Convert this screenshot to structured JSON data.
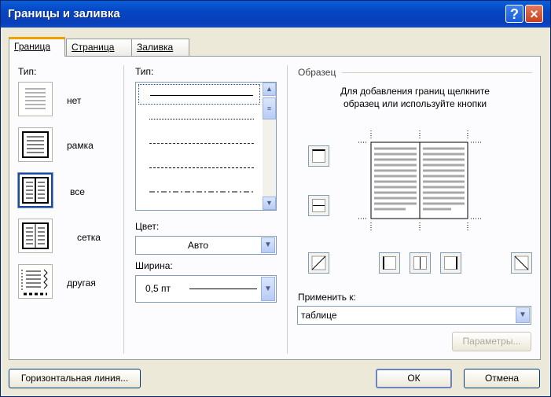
{
  "window": {
    "title": "Границы и заливка",
    "help": "?",
    "close": "×"
  },
  "tabs": [
    {
      "label": "Граница"
    },
    {
      "label": "Страница"
    },
    {
      "label": "Заливка"
    }
  ],
  "settings": {
    "heading": "Тип:",
    "items": [
      {
        "label": "нет"
      },
      {
        "label": "рамка"
      },
      {
        "label": "все"
      },
      {
        "label": "сетка"
      },
      {
        "label": "другая"
      }
    ],
    "selected": "все"
  },
  "style": {
    "heading": "Тип:",
    "styles": [
      "solid",
      "dotted",
      "dashed-fine",
      "dashed",
      "dash-dot"
    ],
    "selected": "solid"
  },
  "color": {
    "label": "Цвет:",
    "value": "Авто"
  },
  "width": {
    "label": "Ширина:",
    "value": "0,5 пт"
  },
  "preview": {
    "heading": "Образец",
    "hint_line1": "Для добавления границ щелкните",
    "hint_line2": "образец или используйте кнопки"
  },
  "apply_to": {
    "label": "Применить к:",
    "value": "таблице"
  },
  "buttons": {
    "options": "Параметры...",
    "horizontal_line": "Горизонтальная линия...",
    "ok": "ОК",
    "cancel": "Отмена"
  }
}
